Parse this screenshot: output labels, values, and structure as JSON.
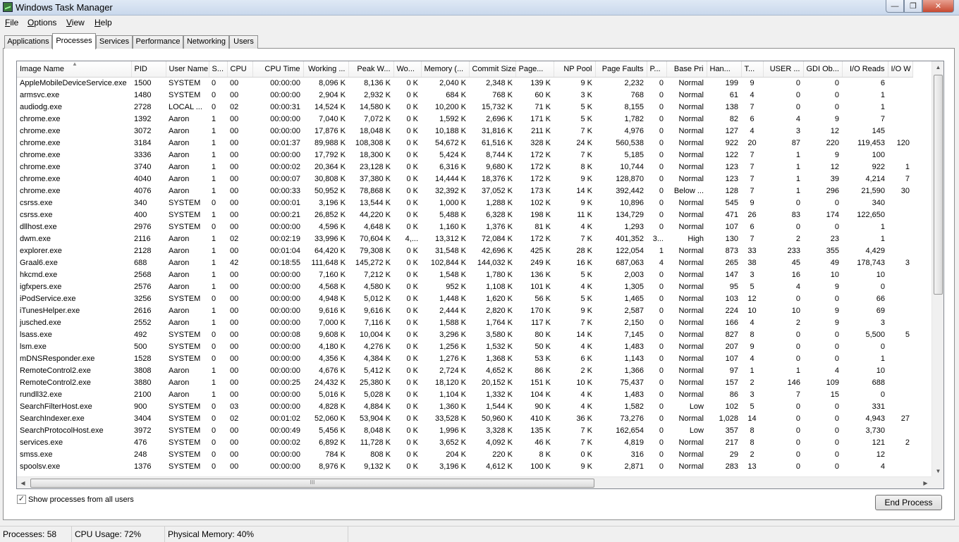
{
  "window": {
    "title": "Windows Task Manager"
  },
  "menu": [
    "File",
    "Options",
    "View",
    "Help"
  ],
  "tabs": [
    "Applications",
    "Processes",
    "Services",
    "Performance",
    "Networking",
    "Users"
  ],
  "active_tab": "Processes",
  "columns": [
    "Image Name",
    "PID",
    "User Name",
    "S...",
    "CPU",
    "CPU Time",
    "Working ...",
    "Peak W...",
    "Wo...",
    "Memory (...",
    "Commit Size",
    "Page...",
    "NP Pool",
    "Page Faults",
    "P...",
    "Base Pri",
    "Han...",
    "T...",
    "USER ...",
    "GDI Ob...",
    "I/O Reads",
    "I/O W"
  ],
  "rows": [
    [
      "AppleMobileDeviceService.exe",
      "1500",
      "SYSTEM",
      "0",
      "00",
      "00:00:00",
      "8,096 K",
      "8,136 K",
      "0 K",
      "2,040 K",
      "2,348 K",
      "139 K",
      "9 K",
      "2,232",
      "0",
      "Normal",
      "199",
      "9",
      "0",
      "0",
      "6",
      ""
    ],
    [
      "armsvc.exe",
      "1480",
      "SYSTEM",
      "0",
      "00",
      "00:00:00",
      "2,904 K",
      "2,932 K",
      "0 K",
      "684 K",
      "768 K",
      "60 K",
      "3 K",
      "768",
      "0",
      "Normal",
      "61",
      "4",
      "0",
      "0",
      "1",
      ""
    ],
    [
      "audiodg.exe",
      "2728",
      "LOCAL ...",
      "0",
      "02",
      "00:00:31",
      "14,524 K",
      "14,580 K",
      "0 K",
      "10,200 K",
      "15,732 K",
      "71 K",
      "5 K",
      "8,155",
      "0",
      "Normal",
      "138",
      "7",
      "0",
      "0",
      "1",
      ""
    ],
    [
      "chrome.exe",
      "1392",
      "Aaron",
      "1",
      "00",
      "00:00:00",
      "7,040 K",
      "7,072 K",
      "0 K",
      "1,592 K",
      "2,696 K",
      "171 K",
      "5 K",
      "1,782",
      "0",
      "Normal",
      "82",
      "6",
      "4",
      "9",
      "7",
      ""
    ],
    [
      "chrome.exe",
      "3072",
      "Aaron",
      "1",
      "00",
      "00:00:00",
      "17,876 K",
      "18,048 K",
      "0 K",
      "10,188 K",
      "31,816 K",
      "211 K",
      "7 K",
      "4,976",
      "0",
      "Normal",
      "127",
      "4",
      "3",
      "12",
      "145",
      ""
    ],
    [
      "chrome.exe",
      "3184",
      "Aaron",
      "1",
      "00",
      "00:01:37",
      "89,988 K",
      "108,308 K",
      "0 K",
      "54,672 K",
      "61,516 K",
      "328 K",
      "24 K",
      "560,538",
      "0",
      "Normal",
      "922",
      "20",
      "87",
      "220",
      "119,453",
      "120"
    ],
    [
      "chrome.exe",
      "3336",
      "Aaron",
      "1",
      "00",
      "00:00:00",
      "17,792 K",
      "18,300 K",
      "0 K",
      "5,424 K",
      "8,744 K",
      "172 K",
      "7 K",
      "5,185",
      "0",
      "Normal",
      "122",
      "7",
      "1",
      "9",
      "100",
      ""
    ],
    [
      "chrome.exe",
      "3740",
      "Aaron",
      "1",
      "00",
      "00:00:02",
      "20,364 K",
      "23,128 K",
      "0 K",
      "6,316 K",
      "9,680 K",
      "172 K",
      "8 K",
      "10,744",
      "0",
      "Normal",
      "123",
      "7",
      "1",
      "12",
      "922",
      "1"
    ],
    [
      "chrome.exe",
      "4040",
      "Aaron",
      "1",
      "00",
      "00:00:07",
      "30,808 K",
      "37,380 K",
      "0 K",
      "14,444 K",
      "18,376 K",
      "172 K",
      "9 K",
      "128,870",
      "0",
      "Normal",
      "123",
      "7",
      "1",
      "39",
      "4,214",
      "7"
    ],
    [
      "chrome.exe",
      "4076",
      "Aaron",
      "1",
      "00",
      "00:00:33",
      "50,952 K",
      "78,868 K",
      "0 K",
      "32,392 K",
      "37,052 K",
      "173 K",
      "14 K",
      "392,442",
      "0",
      "Below ...",
      "128",
      "7",
      "1",
      "296",
      "21,590",
      "30"
    ],
    [
      "csrss.exe",
      "340",
      "SYSTEM",
      "0",
      "00",
      "00:00:01",
      "3,196 K",
      "13,544 K",
      "0 K",
      "1,000 K",
      "1,288 K",
      "102 K",
      "9 K",
      "10,896",
      "0",
      "Normal",
      "545",
      "9",
      "0",
      "0",
      "340",
      ""
    ],
    [
      "csrss.exe",
      "400",
      "SYSTEM",
      "1",
      "00",
      "00:00:21",
      "26,852 K",
      "44,220 K",
      "0 K",
      "5,488 K",
      "6,328 K",
      "198 K",
      "11 K",
      "134,729",
      "0",
      "Normal",
      "471",
      "26",
      "83",
      "174",
      "122,650",
      ""
    ],
    [
      "dllhost.exe",
      "2976",
      "SYSTEM",
      "0",
      "00",
      "00:00:00",
      "4,596 K",
      "4,648 K",
      "0 K",
      "1,160 K",
      "1,376 K",
      "81 K",
      "4 K",
      "1,293",
      "0",
      "Normal",
      "107",
      "6",
      "0",
      "0",
      "1",
      ""
    ],
    [
      "dwm.exe",
      "2116",
      "Aaron",
      "1",
      "02",
      "00:02:19",
      "33,996 K",
      "70,604 K",
      "4,...",
      "13,312 K",
      "72,084 K",
      "172 K",
      "7 K",
      "401,352",
      "3...",
      "High",
      "130",
      "7",
      "2",
      "23",
      "1",
      ""
    ],
    [
      "explorer.exe",
      "2128",
      "Aaron",
      "1",
      "00",
      "00:01:04",
      "64,420 K",
      "79,308 K",
      "0 K",
      "31,548 K",
      "42,696 K",
      "425 K",
      "28 K",
      "122,054",
      "1",
      "Normal",
      "873",
      "33",
      "233",
      "355",
      "4,429",
      ""
    ],
    [
      "Graal6.exe",
      "688",
      "Aaron",
      "1",
      "42",
      "00:18:55",
      "111,648 K",
      "145,272 K",
      "0 K",
      "102,844 K",
      "144,032 K",
      "249 K",
      "16 K",
      "687,063",
      "4",
      "Normal",
      "265",
      "38",
      "45",
      "49",
      "178,743",
      "3"
    ],
    [
      "hkcmd.exe",
      "2568",
      "Aaron",
      "1",
      "00",
      "00:00:00",
      "7,160 K",
      "7,212 K",
      "0 K",
      "1,548 K",
      "1,780 K",
      "136 K",
      "5 K",
      "2,003",
      "0",
      "Normal",
      "147",
      "3",
      "16",
      "10",
      "10",
      ""
    ],
    [
      "igfxpers.exe",
      "2576",
      "Aaron",
      "1",
      "00",
      "00:00:00",
      "4,568 K",
      "4,580 K",
      "0 K",
      "952 K",
      "1,108 K",
      "101 K",
      "4 K",
      "1,305",
      "0",
      "Normal",
      "95",
      "5",
      "4",
      "9",
      "0",
      ""
    ],
    [
      "iPodService.exe",
      "3256",
      "SYSTEM",
      "0",
      "00",
      "00:00:00",
      "4,948 K",
      "5,012 K",
      "0 K",
      "1,448 K",
      "1,620 K",
      "56 K",
      "5 K",
      "1,465",
      "0",
      "Normal",
      "103",
      "12",
      "0",
      "0",
      "66",
      ""
    ],
    [
      "iTunesHelper.exe",
      "2616",
      "Aaron",
      "1",
      "00",
      "00:00:00",
      "9,616 K",
      "9,616 K",
      "0 K",
      "2,444 K",
      "2,820 K",
      "170 K",
      "9 K",
      "2,587",
      "0",
      "Normal",
      "224",
      "10",
      "10",
      "9",
      "69",
      ""
    ],
    [
      "jusched.exe",
      "2552",
      "Aaron",
      "1",
      "00",
      "00:00:00",
      "7,000 K",
      "7,116 K",
      "0 K",
      "1,588 K",
      "1,764 K",
      "117 K",
      "7 K",
      "2,150",
      "0",
      "Normal",
      "166",
      "4",
      "2",
      "9",
      "3",
      ""
    ],
    [
      "lsass.exe",
      "492",
      "SYSTEM",
      "0",
      "00",
      "00:00:08",
      "9,608 K",
      "10,004 K",
      "0 K",
      "3,296 K",
      "3,580 K",
      "80 K",
      "14 K",
      "7,145",
      "0",
      "Normal",
      "827",
      "8",
      "0",
      "0",
      "5,500",
      "5"
    ],
    [
      "lsm.exe",
      "500",
      "SYSTEM",
      "0",
      "00",
      "00:00:00",
      "4,180 K",
      "4,276 K",
      "0 K",
      "1,256 K",
      "1,532 K",
      "50 K",
      "4 K",
      "1,483",
      "0",
      "Normal",
      "207",
      "9",
      "0",
      "0",
      "0",
      ""
    ],
    [
      "mDNSResponder.exe",
      "1528",
      "SYSTEM",
      "0",
      "00",
      "00:00:00",
      "4,356 K",
      "4,384 K",
      "0 K",
      "1,276 K",
      "1,368 K",
      "53 K",
      "6 K",
      "1,143",
      "0",
      "Normal",
      "107",
      "4",
      "0",
      "0",
      "1",
      ""
    ],
    [
      "RemoteControl2.exe",
      "3808",
      "Aaron",
      "1",
      "00",
      "00:00:00",
      "4,676 K",
      "5,412 K",
      "0 K",
      "2,724 K",
      "4,652 K",
      "86 K",
      "2 K",
      "1,366",
      "0",
      "Normal",
      "97",
      "1",
      "1",
      "4",
      "10",
      ""
    ],
    [
      "RemoteControl2.exe",
      "3880",
      "Aaron",
      "1",
      "00",
      "00:00:25",
      "24,432 K",
      "25,380 K",
      "0 K",
      "18,120 K",
      "20,152 K",
      "151 K",
      "10 K",
      "75,437",
      "0",
      "Normal",
      "157",
      "2",
      "146",
      "109",
      "688",
      ""
    ],
    [
      "rundll32.exe",
      "2100",
      "Aaron",
      "1",
      "00",
      "00:00:00",
      "5,016 K",
      "5,028 K",
      "0 K",
      "1,104 K",
      "1,332 K",
      "104 K",
      "4 K",
      "1,483",
      "0",
      "Normal",
      "86",
      "3",
      "7",
      "15",
      "0",
      ""
    ],
    [
      "SearchFilterHost.exe",
      "900",
      "SYSTEM",
      "0",
      "03",
      "00:00:00",
      "4,828 K",
      "4,884 K",
      "0 K",
      "1,360 K",
      "1,544 K",
      "90 K",
      "4 K",
      "1,582",
      "0",
      "Low",
      "102",
      "5",
      "0",
      "0",
      "331",
      ""
    ],
    [
      "SearchIndexer.exe",
      "3404",
      "SYSTEM",
      "0",
      "02",
      "00:01:02",
      "52,060 K",
      "53,904 K",
      "0 K",
      "33,528 K",
      "50,960 K",
      "410 K",
      "36 K",
      "73,276",
      "0",
      "Normal",
      "1,028",
      "14",
      "0",
      "0",
      "4,943",
      "27"
    ],
    [
      "SearchProtocolHost.exe",
      "3972",
      "SYSTEM",
      "0",
      "00",
      "00:00:49",
      "5,456 K",
      "8,048 K",
      "0 K",
      "1,996 K",
      "3,328 K",
      "135 K",
      "7 K",
      "162,654",
      "0",
      "Low",
      "357",
      "8",
      "0",
      "0",
      "3,730",
      ""
    ],
    [
      "services.exe",
      "476",
      "SYSTEM",
      "0",
      "00",
      "00:00:02",
      "6,892 K",
      "11,728 K",
      "0 K",
      "3,652 K",
      "4,092 K",
      "46 K",
      "7 K",
      "4,819",
      "0",
      "Normal",
      "217",
      "8",
      "0",
      "0",
      "121",
      "2"
    ],
    [
      "smss.exe",
      "248",
      "SYSTEM",
      "0",
      "00",
      "00:00:00",
      "784 K",
      "808 K",
      "0 K",
      "204 K",
      "220 K",
      "8 K",
      "0 K",
      "316",
      "0",
      "Normal",
      "29",
      "2",
      "0",
      "0",
      "12",
      ""
    ],
    [
      "spoolsv.exe",
      "1376",
      "SYSTEM",
      "0",
      "00",
      "00:00:00",
      "8,976 K",
      "9,132 K",
      "0 K",
      "3,196 K",
      "4,612 K",
      "100 K",
      "9 K",
      "2,871",
      "0",
      "Normal",
      "283",
      "13",
      "0",
      "0",
      "4",
      ""
    ]
  ],
  "show_all_label": "Show processes from all users",
  "show_all_checked": "✓",
  "end_process_label": "End Process",
  "status": {
    "processes": "Processes: 58",
    "cpu": "CPU Usage: 72%",
    "memory": "Physical Memory: 40%"
  },
  "hscroll_grip": "III"
}
